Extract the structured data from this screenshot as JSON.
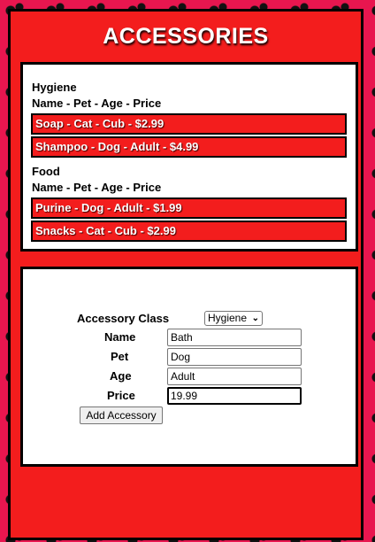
{
  "header": {
    "title": "ACCESSORIES"
  },
  "list": {
    "columns_label": "Name - Pet - Age - Price",
    "categories": [
      {
        "name": "Hygiene",
        "items": [
          "Soap - Cat - Cub - $2.99",
          "Shampoo - Dog - Adult - $4.99"
        ]
      },
      {
        "name": "Food",
        "items": [
          "Purine - Dog - Adult - $1.99",
          "Snacks - Cat - Cub - $2.99"
        ]
      }
    ]
  },
  "form": {
    "class_label": "Accessory Class",
    "class_selected": "Hygiene",
    "name_label": "Name",
    "name_value": "Bath",
    "pet_label": "Pet",
    "pet_value": "Dog",
    "age_label": "Age",
    "age_value": "Adult",
    "price_label": "Price",
    "price_value": "19.99",
    "submit_label": "Add Accessory"
  },
  "colors": {
    "accent": "#f31d1d",
    "backdrop": "#e8164f",
    "border": "#000000"
  },
  "icons": {
    "select": "chevron-down-icon"
  }
}
